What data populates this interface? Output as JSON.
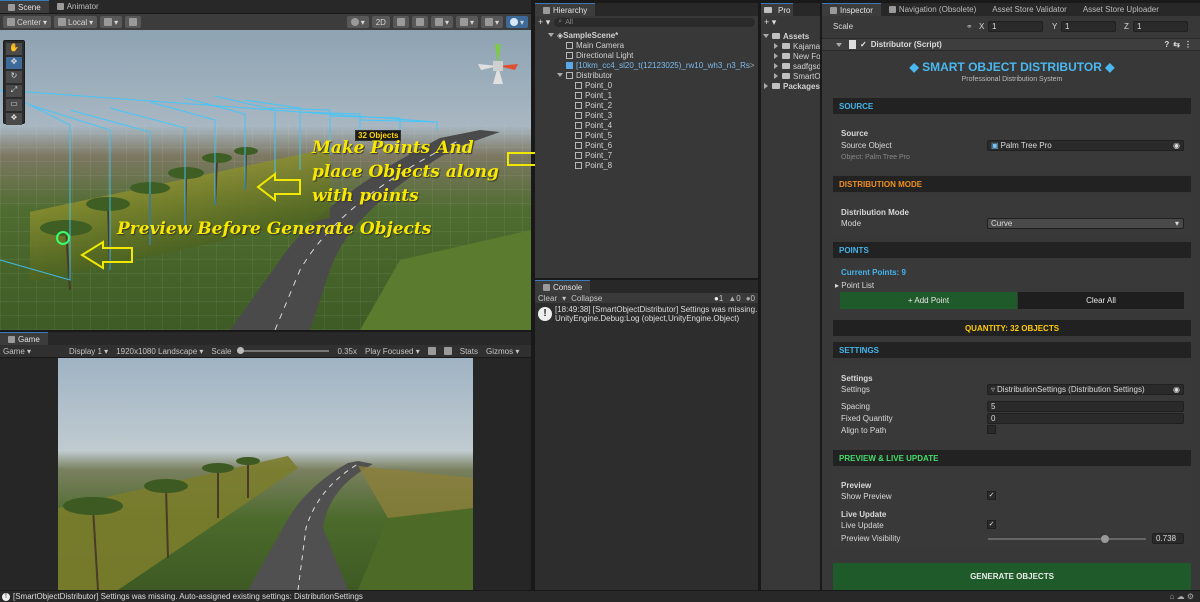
{
  "scene": {
    "tabs": [
      "Scene",
      "Animator"
    ],
    "toolbar": {
      "pivot": "Center",
      "space": "Local",
      "mode2d": "2D"
    },
    "objects_label": "32 Objects",
    "annotations": {
      "line1": "Make Points And",
      "line2": "place Objects along",
      "line3": "with points",
      "preview": "Preview Before Generate Objects"
    }
  },
  "game": {
    "tab": "Game",
    "toolbar": {
      "mode": "Game",
      "display": "Display 1",
      "resolution": "1920x1080 Landscape",
      "scale_label": "Scale",
      "scale_value": "0.35x",
      "play_focused": "Play Focused",
      "stats": "Stats",
      "gizmos": "Gizmos"
    }
  },
  "hierarchy": {
    "tab": "Hierarchy",
    "search_placeholder": "All",
    "items": [
      {
        "label": "SampleScene*",
        "level": 0,
        "kind": "scene"
      },
      {
        "label": "Main Camera",
        "level": 1,
        "kind": "object"
      },
      {
        "label": "Directional Light",
        "level": 1,
        "kind": "object"
      },
      {
        "label": "[10km_cc4_sl20_t(12123025)_rw10_wh3_n3_Rs",
        "level": 1,
        "kind": "prefab"
      },
      {
        "label": "Distributor",
        "level": 1,
        "kind": "parent"
      },
      {
        "label": "Point_0",
        "level": 2,
        "kind": "object"
      },
      {
        "label": "Point_1",
        "level": 2,
        "kind": "object"
      },
      {
        "label": "Point_2",
        "level": 2,
        "kind": "object"
      },
      {
        "label": "Point_3",
        "level": 2,
        "kind": "object"
      },
      {
        "label": "Point_4",
        "level": 2,
        "kind": "object"
      },
      {
        "label": "Point_5",
        "level": 2,
        "kind": "object"
      },
      {
        "label": "Point_6",
        "level": 2,
        "kind": "object"
      },
      {
        "label": "Point_7",
        "level": 2,
        "kind": "object"
      },
      {
        "label": "Point_8",
        "level": 2,
        "kind": "object"
      }
    ]
  },
  "console": {
    "tab": "Console",
    "clear": "Clear",
    "collapse": "Collapse",
    "counts": {
      "info": "1",
      "warn": "0",
      "error": "0"
    },
    "message_line1": "[18:49:38] [SmartObjectDistributor] Settings was missing.",
    "message_line2": "UnityEngine.Debug:Log (object,UnityEngine.Object)"
  },
  "project": {
    "tab": "Pro",
    "assets_label": "Assets",
    "folders": [
      "Kajaman",
      "New Fold",
      "sadfgsdg",
      "SmartOb"
    ],
    "packages_label": "Packages"
  },
  "inspector": {
    "tabs": [
      "Inspector",
      "Navigation (Obsolete)",
      "Asset Store Validator",
      "Asset Store Uploader"
    ],
    "scale": {
      "label": "Scale",
      "x": "1",
      "y": "1",
      "z": "1"
    },
    "component": "Distributor (Script)",
    "title": "SMART OBJECT DISTRIBUTOR",
    "subtitle": "Professional Distribution System",
    "source": {
      "header": "SOURCE",
      "group": "Source",
      "label": "Source Object",
      "value": "Palm Tree Pro",
      "hint": "Object: Palm Tree Pro"
    },
    "distribution": {
      "header": "DISTRIBUTION MODE",
      "group": "Distribution Mode",
      "label": "Mode",
      "value": "Curve"
    },
    "points": {
      "header": "POINTS",
      "current": "Current Points: 9",
      "list_label": "Point List",
      "add_button": "+ Add Point",
      "clear_button": "Clear All"
    },
    "quantity": "QUANTITY: 32 OBJECTS",
    "settings": {
      "header": "SETTINGS",
      "group": "Settings",
      "settings_label": "Settings",
      "settings_value": "DistributionSettings (Distribution Settings)",
      "spacing_label": "Spacing",
      "spacing_value": "5",
      "fixed_label": "Fixed Quantity",
      "fixed_value": "0",
      "align_label": "Align to Path"
    },
    "preview": {
      "header": "PREVIEW & LIVE UPDATE",
      "group1": "Preview",
      "show_label": "Show Preview",
      "group2": "Live Update",
      "live_label": "Live Update",
      "visibility_label": "Preview Visibility",
      "visibility_value": "0.738",
      "visibility_fraction": 0.738
    },
    "generate_button": "GENERATE OBJECTS"
  },
  "status_bar": "[SmartObjectDistributor] Settings was missing. Auto-assigned existing settings: DistributionSettings"
}
